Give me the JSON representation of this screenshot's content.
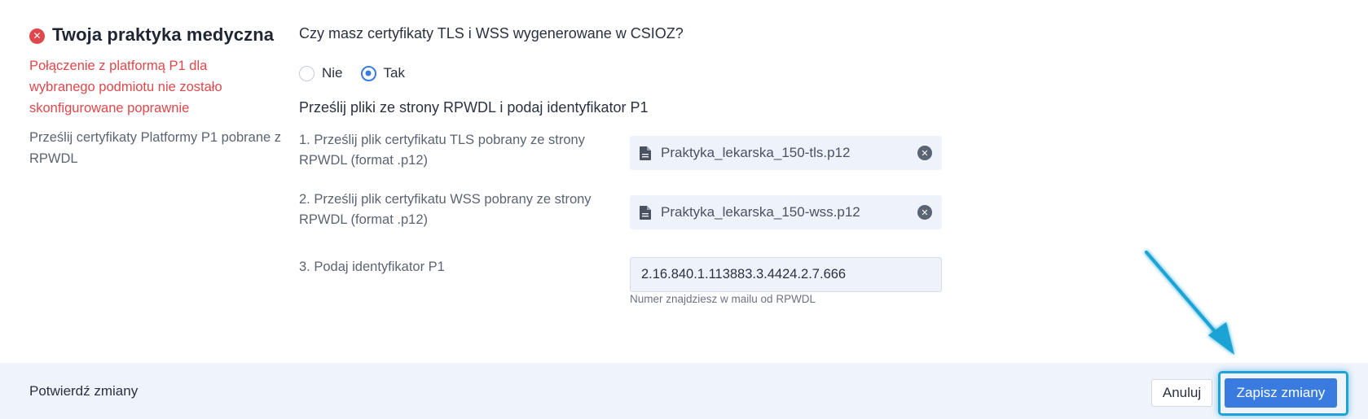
{
  "left": {
    "title": "Twoja praktyka medyczna",
    "error_message": "Połączenie z platformą P1 dla wybranego podmiotu nie zostało skonfigurowane poprawnie",
    "description": "Prześlij certyfikaty Platformy P1 pobrane z RPWDL",
    "icon": "error-icon"
  },
  "question_certs": "Czy masz certyfikaty TLS i WSS wygenerowane w CSIOZ?",
  "radio": {
    "options": [
      {
        "label": "Nie",
        "checked": false
      },
      {
        "label": "Tak",
        "checked": true
      }
    ]
  },
  "section_title": "Prześlij pliki ze strony RPWDL i podaj identyfikator P1",
  "fields": {
    "tls": {
      "label": "1. Prześlij plik certyfikatu TLS pobrany ze strony RPWDL (format .p12)",
      "file": "Praktyka_lekarska_150-tls.p12"
    },
    "wss": {
      "label": "2. Prześlij plik certyfikatu WSS pobrany ze strony RPWDL (format .p12)",
      "file": "Praktyka_lekarska_150-wss.p12"
    },
    "p1id": {
      "label": "3. Podaj identyfikator P1",
      "value": "2.16.840.1.113883.3.4424.2.7.666",
      "hint": "Numer znajdziesz w mailu od RPWDL"
    }
  },
  "footer": {
    "label": "Potwierdź zmiany",
    "cancel": "Anuluj",
    "save": "Zapisz zmiany"
  },
  "colors": {
    "error": "#e0474b",
    "primary": "#3a7be0",
    "highlight": "#1ea3d6",
    "footer_bg": "#eff3fb"
  }
}
